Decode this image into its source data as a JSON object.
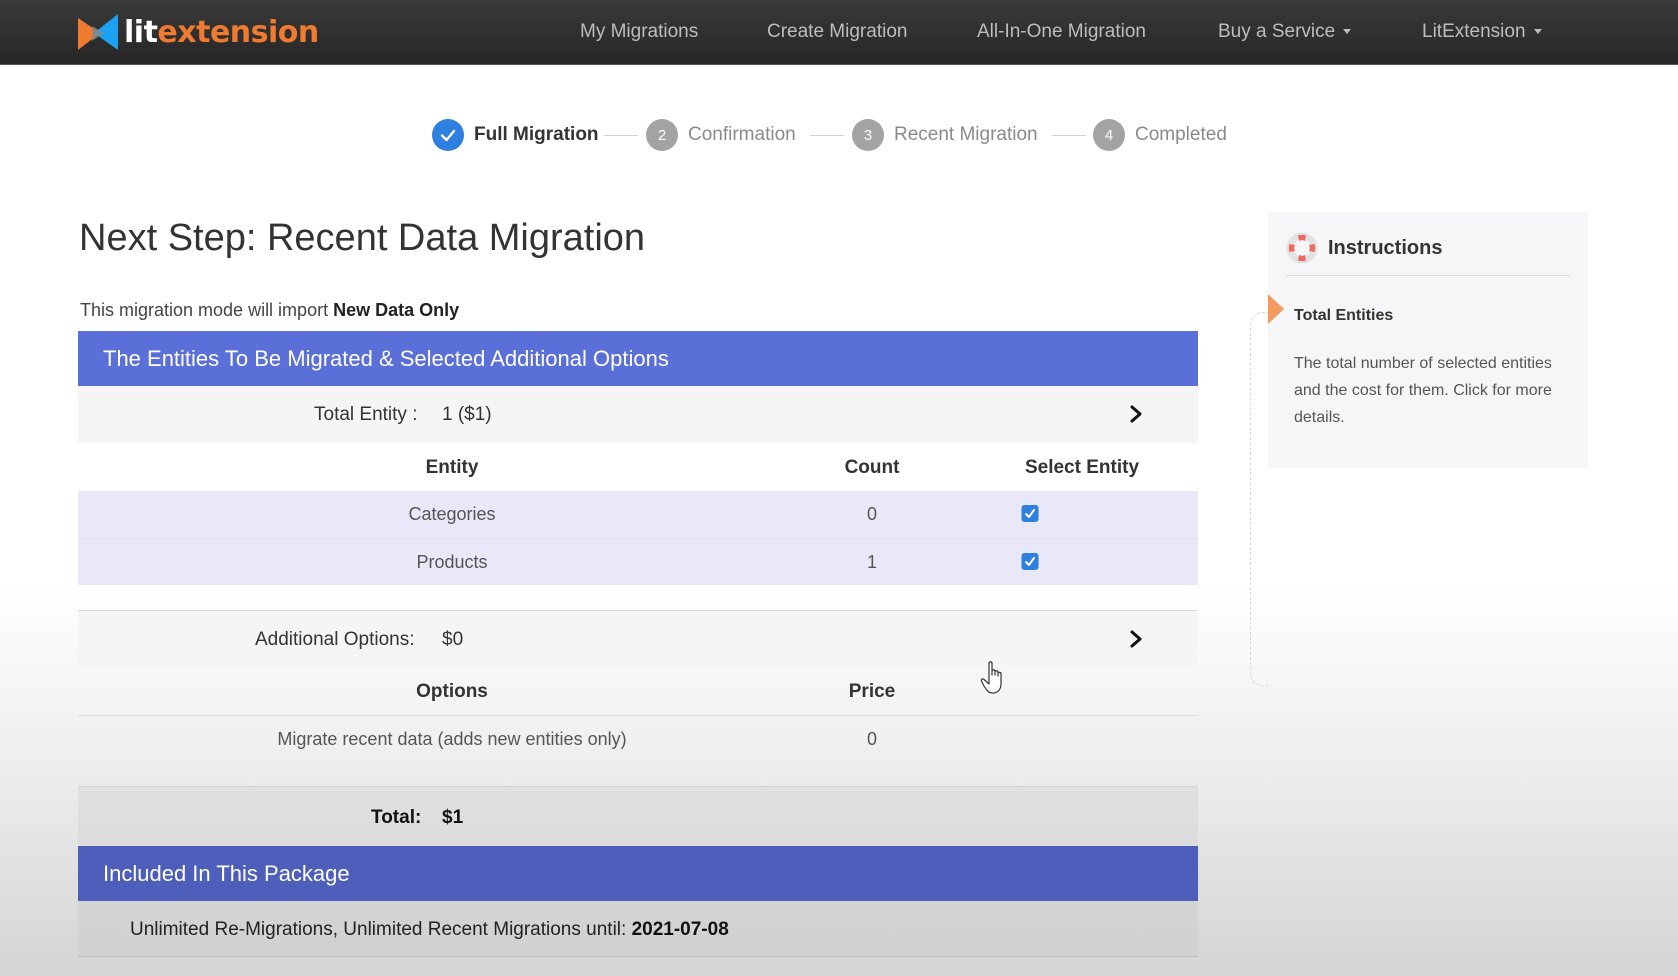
{
  "navbar": {
    "logo": {
      "part1": "lit",
      "part2": "extension"
    },
    "links": [
      {
        "label": "My Migrations",
        "has_caret": false
      },
      {
        "label": "Create Migration",
        "has_caret": false
      },
      {
        "label": "All-In-One Migration",
        "has_caret": false
      },
      {
        "label": "Buy a Service",
        "has_caret": true
      },
      {
        "label": "LitExtension",
        "has_caret": true
      }
    ]
  },
  "stepper": {
    "steps": [
      {
        "number": "1",
        "label": "Full Migration",
        "state": "completed",
        "icon": "check-icon"
      },
      {
        "number": "2",
        "label": "Confirmation",
        "state": "pending"
      },
      {
        "number": "3",
        "label": "Recent Migration",
        "state": "pending"
      },
      {
        "number": "4",
        "label": "Completed",
        "state": "pending"
      }
    ]
  },
  "page": {
    "title": "Next Step: Recent Data Migration",
    "mode_prefix": "This migration mode will import",
    "mode_value": "New Data Only"
  },
  "entities_panel": {
    "header": "The Entities To Be Migrated & Selected Additional Options",
    "total_entity_label": "Total Entity :",
    "total_entity_value": "1 ($1)",
    "columns": [
      "Entity",
      "Count",
      "Select Entity"
    ],
    "rows": [
      {
        "entity": "Categories",
        "count": "0",
        "selected": true
      },
      {
        "entity": "Products",
        "count": "1",
        "selected": true
      }
    ],
    "additional_options_label": "Additional Options:",
    "additional_options_value": "$0",
    "option_columns": [
      "Options",
      "Price"
    ],
    "options": [
      {
        "name": "Migrate recent data (adds new entities only)",
        "price": "0"
      }
    ],
    "total_label": "Total:",
    "total_value": "$1"
  },
  "package_panel": {
    "header": "Included In This Package",
    "text": "Unlimited Re-Migrations, Unlimited Recent Migrations until:",
    "date": "2021-07-08"
  },
  "instructions": {
    "title": "Instructions",
    "icon": "lifebuoy-icon",
    "subtitle": "Total Entities",
    "body": "The total number of selected entities and the cost for them. Click for more details."
  },
  "colors": {
    "navbar_bg": "#2e2e2e",
    "brand_orange": "#ef7b30",
    "brand_blue": "#1da1f2",
    "panel_header": "#5a6fd8",
    "package_header": "#4e5fbb",
    "step_done": "#2f7fe0",
    "step_pending": "#a3a3a3",
    "selected_row": "#e8e8f8",
    "instructions_accent": "#f39a5e"
  }
}
